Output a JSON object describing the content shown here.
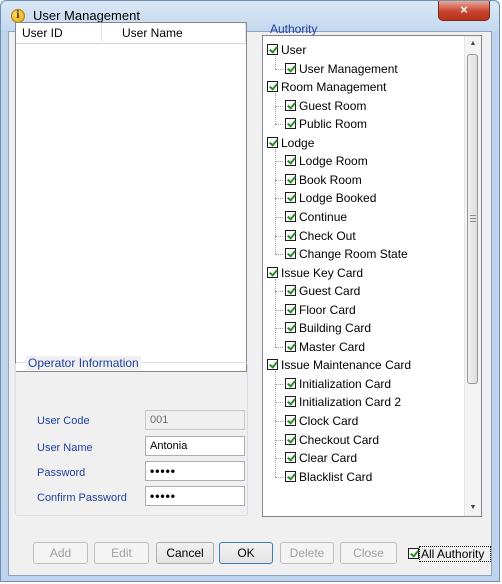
{
  "window": {
    "title": "User Management",
    "close_glyph": "×"
  },
  "user_list": {
    "columns": [
      "User ID",
      "User Name"
    ]
  },
  "operator_info": {
    "title": "Operator Information",
    "user_code_label": "User Code",
    "user_code_value": "001",
    "user_name_label": "User Name",
    "user_name_value": "Antonia",
    "password_label": "Password",
    "password_value": "•••••",
    "confirm_label": "Confirm Password",
    "confirm_value": "•••••"
  },
  "authority": {
    "title": "Authority",
    "items": [
      {
        "label": "User",
        "level": 0,
        "checked": true
      },
      {
        "label": "User Management",
        "level": 1,
        "checked": true
      },
      {
        "label": "Room Management",
        "level": 0,
        "checked": true
      },
      {
        "label": "Guest Room",
        "level": 1,
        "checked": true
      },
      {
        "label": "Public Room",
        "level": 1,
        "checked": true
      },
      {
        "label": "Lodge",
        "level": 0,
        "checked": true
      },
      {
        "label": "Lodge Room",
        "level": 1,
        "checked": true
      },
      {
        "label": "Book Room",
        "level": 1,
        "checked": true
      },
      {
        "label": "Lodge Booked",
        "level": 1,
        "checked": true
      },
      {
        "label": "Continue",
        "level": 1,
        "checked": true
      },
      {
        "label": "Check Out",
        "level": 1,
        "checked": true
      },
      {
        "label": "Change Room State",
        "level": 1,
        "checked": true
      },
      {
        "label": "Issue Key Card",
        "level": 0,
        "checked": true
      },
      {
        "label": "Guest Card",
        "level": 1,
        "checked": true
      },
      {
        "label": "Floor Card",
        "level": 1,
        "checked": true
      },
      {
        "label": "Building Card",
        "level": 1,
        "checked": true
      },
      {
        "label": "Master Card",
        "level": 1,
        "checked": true
      },
      {
        "label": "Issue Maintenance Card",
        "level": 0,
        "checked": true
      },
      {
        "label": "Initialization Card",
        "level": 1,
        "checked": true
      },
      {
        "label": "Initialization Card 2",
        "level": 1,
        "checked": true
      },
      {
        "label": "Clock Card",
        "level": 1,
        "checked": true
      },
      {
        "label": "Checkout Card",
        "level": 1,
        "checked": true
      },
      {
        "label": "Clear Card",
        "level": 1,
        "checked": true
      },
      {
        "label": "Blacklist Card",
        "level": 1,
        "checked": true
      }
    ]
  },
  "buttons": {
    "add": "Add",
    "edit": "Edit",
    "cancel": "Cancel",
    "ok": "OK",
    "delete": "Delete",
    "close": "Close"
  },
  "all_authority": {
    "label": "All Authority",
    "checked": true
  },
  "colors": {
    "accent": "#1f3f9f",
    "title_bar": "#c4d8ee",
    "close": "#c7442e"
  }
}
